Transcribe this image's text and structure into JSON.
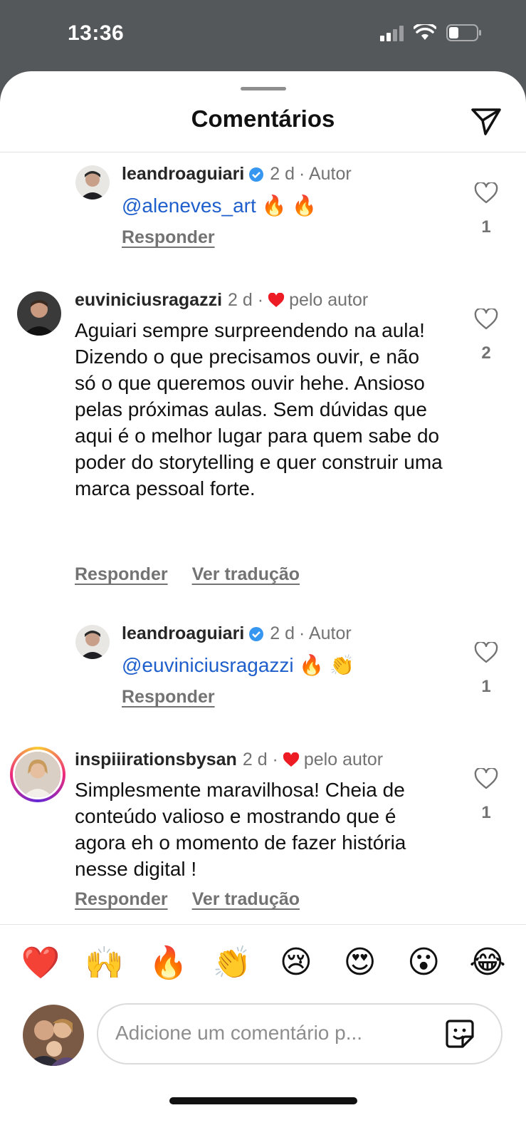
{
  "status_bar": {
    "time": "13:36"
  },
  "sheet": {
    "title": "Comentários"
  },
  "comments": [
    {
      "username": "leandroaguiari",
      "time": "2 d",
      "tag": "· Autor",
      "mention": "@aleneves_art",
      "text": "🔥 🔥",
      "actions": [
        "Responder"
      ],
      "likes": "1"
    },
    {
      "username": "euviniciusragazzi",
      "time": "2 d ·",
      "tag": "pelo autor",
      "text": "Aguiari sempre surpreendendo na aula! Dizendo o que precisamos ouvir, e não só o que queremos ouvir hehe. Ansioso pelas próximas aulas. Sem dúvidas que aqui é o melhor lugar para quem sabe do poder do storytelling e quer construir uma marca pessoal forte.",
      "actions": [
        "Responder",
        "Ver tradução"
      ],
      "likes": "2"
    },
    {
      "username": "leandroaguiari",
      "time": "2 d",
      "tag": "· Autor",
      "mention": "@euviniciusragazzi",
      "text": "🔥 👏",
      "actions": [
        "Responder"
      ],
      "likes": "1"
    },
    {
      "username": "inspiiirationsbysan",
      "time": "2 d ·",
      "tag": "pelo autor",
      "text": "Simplesmente maravilhosa! Cheia de conteúdo valioso e mostrando que é agora eh o momento de fazer história nesse digital !",
      "actions": [
        "Responder",
        "Ver tradução"
      ],
      "likes": "1"
    }
  ],
  "reactions": [
    "❤️",
    "🙌",
    "🔥",
    "👏",
    "😢",
    "😍",
    "😮",
    "😂"
  ],
  "composer": {
    "placeholder": "Adicione um comentário p..."
  },
  "colors": {
    "mention": "#1f5fcc",
    "verified": "#3797f0",
    "heart": "#ed1c24"
  }
}
